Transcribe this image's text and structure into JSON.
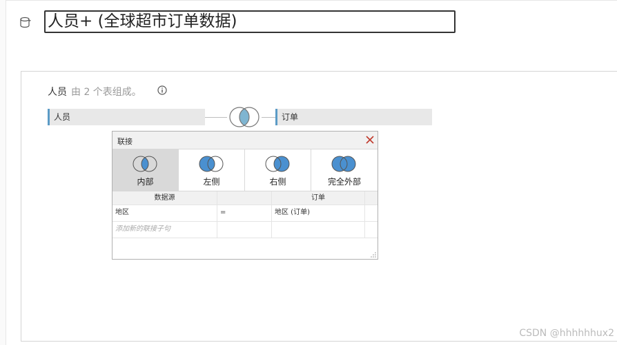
{
  "app": {
    "datasource_title": "人员+ (全球超市订单数据)"
  },
  "canvas": {
    "table_name": "人员",
    "table_note": "由 2 个表组成。",
    "left_table": "人员",
    "right_table": "订单"
  },
  "join_dialog": {
    "title": "联接",
    "join_types": [
      {
        "label": "内部",
        "selected": true
      },
      {
        "label": "左侧",
        "selected": false
      },
      {
        "label": "右侧",
        "selected": false
      },
      {
        "label": "完全外部",
        "selected": false
      }
    ],
    "columns": {
      "left": "数据源",
      "right": "订单"
    },
    "clauses": [
      {
        "left": "地区",
        "operator": "=",
        "right": "地区 (订单)"
      }
    ],
    "add_clause_placeholder": "添加新的联接子句"
  },
  "colors": {
    "accent": "#4a90d0",
    "venn_fill": "#7fb5d1",
    "table_bar_accent": "#5b9bc6",
    "close_red": "#c0392b"
  },
  "watermark": "CSDN @hhhhhhux2"
}
